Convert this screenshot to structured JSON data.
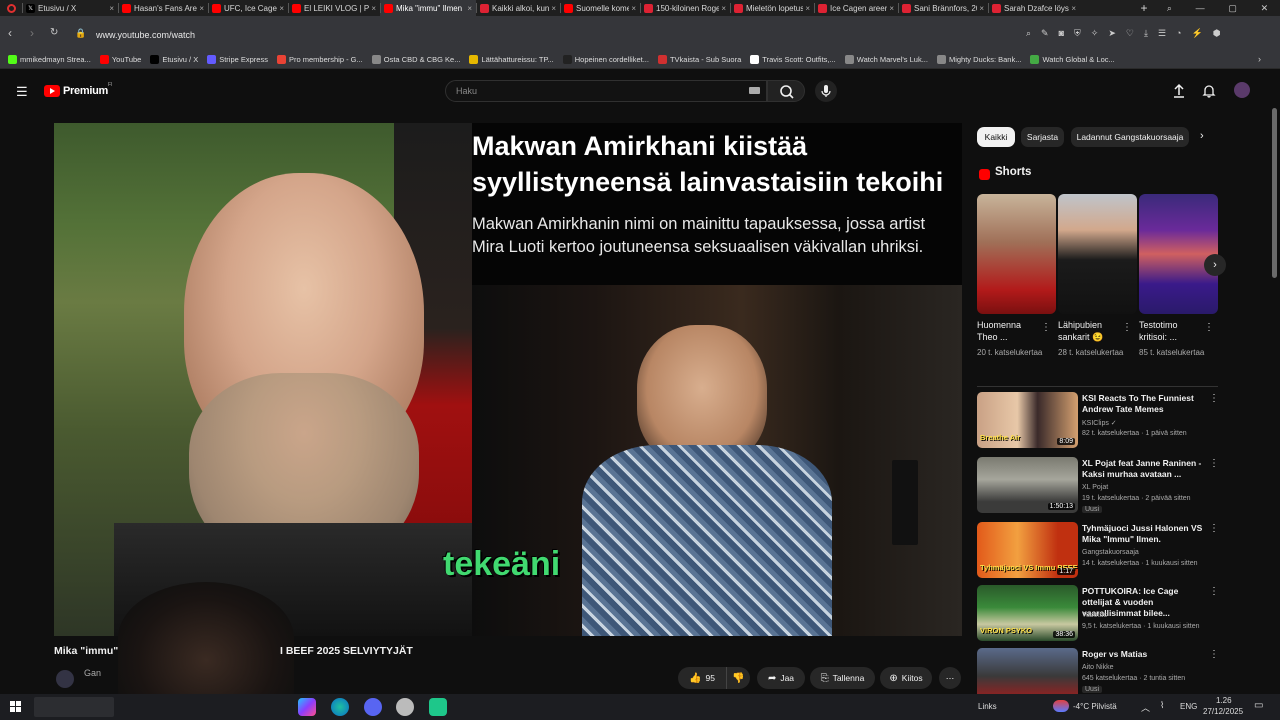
{
  "browser": {
    "tabs": [
      {
        "title": "Etusivu / X",
        "favicon": "x-icon",
        "active": false
      },
      {
        "title": "Hasan's Fans Are F",
        "favicon": "youtube-icon",
        "active": false
      },
      {
        "title": "UFC, Ice Cage ja sp",
        "favicon": "youtube-icon",
        "active": false
      },
      {
        "title": "El LEIKI VLOG | PIIK",
        "favicon": "youtube-icon",
        "active": false
      },
      {
        "title": "Mika \"immu\" Ilmen",
        "favicon": "youtube-icon",
        "active": true
      },
      {
        "title": "Kaikki alkoi, kun Im",
        "favicon": "news-icon",
        "active": false
      },
      {
        "title": "Suomelle komea vo",
        "favicon": "youtube-icon",
        "active": false
      },
      {
        "title": "150-kiloinen Roger",
        "favicon": "news-icon",
        "active": false
      },
      {
        "title": "Mieletön lopetus! S",
        "favicon": "news-icon",
        "active": false
      },
      {
        "title": "Ice Cagen areenan",
        "favicon": "news-icon",
        "active": false
      },
      {
        "title": "Sani Brännfors, 20,",
        "favicon": "news-icon",
        "active": false
      },
      {
        "title": "Sarah Dzafce löysi t",
        "favicon": "news-icon",
        "active": false
      }
    ],
    "new_tab_label": "+",
    "url": "www.youtube.com/watch",
    "bookmarks": [
      {
        "label": "mmikedmayn Strea...",
        "icon": "kick-icon",
        "color": "#53fc18"
      },
      {
        "label": "YouTube",
        "icon": "youtube-icon",
        "color": "#ff0000"
      },
      {
        "label": "Etusivu / X",
        "icon": "x-icon",
        "color": "#000000"
      },
      {
        "label": "Stripe Express",
        "icon": "stripe-icon",
        "color": "#635bff"
      },
      {
        "label": "Pro membership - G...",
        "icon": "location-icon",
        "color": "#ea4335"
      },
      {
        "label": "Osta CBD & CBG Ke...",
        "icon": "leaf-icon",
        "color": "#888888"
      },
      {
        "label": "Lättähattureissu: TP...",
        "icon": "page-icon",
        "color": "#e6b800"
      },
      {
        "label": "Hopeinen cordelliket...",
        "icon": "nt-icon",
        "color": "#222222"
      },
      {
        "label": "TVkaista - Sub Suora",
        "icon": "tv-icon",
        "color": "#d03030"
      },
      {
        "label": "Travis Scott: Outfits,...",
        "icon": "w-icon",
        "color": "#ffffff"
      },
      {
        "label": "Watch Marvel's Luk...",
        "icon": "gear-icon",
        "color": "#888888"
      },
      {
        "label": "Mighty Ducks: Bank...",
        "icon": "bolt-icon",
        "color": "#888888"
      },
      {
        "label": "Watch Global & Loc...",
        "icon": "globe-icon",
        "color": "#44aa44"
      }
    ]
  },
  "youtube": {
    "logo_text": "Premium",
    "logo_superscript": "FI",
    "search_placeholder": "Haku",
    "video": {
      "headline_line1": "Makwan Amirkhani kiistää",
      "headline_line2": "syyllistyneensä lainvastaisiin tekoihi",
      "sub_line1": "Makwan Amirkhanin nimi on mainittu tapauksessa, jossa artist",
      "sub_line2": "Mira Luoti kertoo joutuneensa seksuaalisen väkivallan uhriksi.",
      "caption": "tekeäni",
      "title_left": "Mika \"immu\"",
      "title_right": "I BEEF 2025 SELVIYTYJÄT",
      "channel_partial": "Gan"
    },
    "actions": {
      "like_count": "95",
      "share_label": "Jaa",
      "save_label": "Tallenna",
      "thanks_label": "Kiitos"
    },
    "chips": [
      {
        "label": "Kaikki",
        "active": true
      },
      {
        "label": "Sarjasta",
        "active": false
      },
      {
        "label": "Ladannut Gangstakuorsaaja",
        "active": false
      }
    ],
    "shorts_heading": "Shorts",
    "shorts": [
      {
        "title": "Huomenna Theo ...",
        "views": "20 t. katselukertaa"
      },
      {
        "title": "Lähipubien sankarit 😉",
        "views": "28 t. katselukertaa"
      },
      {
        "title": "Testotimo kritisoi: ...",
        "views": "85 t. katselukertaa"
      }
    ],
    "recommended": [
      {
        "title": "KSI Reacts To The Funniest Andrew Tate Memes",
        "channel": "KSIClips ✓",
        "meta": "82 t. katselukertaa · 1 päivä sitten",
        "duration": "8:09",
        "badge": "",
        "thumb_text": "Breathe Air"
      },
      {
        "title": "XL Pojat feat Janne Raninen - Kaksi murhaa avataan ...",
        "channel": "XL Pojat",
        "meta": "19 t. katselukertaa · 2 päivää sitten",
        "duration": "1:50:13",
        "badge": "Uusi",
        "thumb_text": ""
      },
      {
        "title": "Tyhmäjuoci Jussi Halonen VS Mika \"Immu\" Ilmen.",
        "channel": "Gangstakuorsaaja",
        "meta": "14 t. katselukertaa · 1 kuukausi sitten",
        "duration": "1:17",
        "badge": "",
        "thumb_text": "Tyhmäjuoci VS Immu BEEF"
      },
      {
        "title": "POTTUKOIRA: Ice Cage ottelijat & vuoden vaarallisimmat bilee...",
        "channel": "Tubetus",
        "meta": "9,5 t. katselukertaa · 1 kuukausi sitten",
        "duration": "38:36",
        "badge": "",
        "thumb_text": "VIRON PSYKO"
      },
      {
        "title": "Roger vs Matias",
        "channel": "Aito Nikke",
        "meta": "645 katselukertaa · 2 tuntia sitten",
        "duration": "",
        "badge": "Uusi",
        "thumb_text": ""
      }
    ]
  },
  "taskbar": {
    "links_label": "Links",
    "weather": "-4°C  Pilvistä",
    "language": "ENG",
    "time": "1.26",
    "date": "27/12/2025"
  }
}
